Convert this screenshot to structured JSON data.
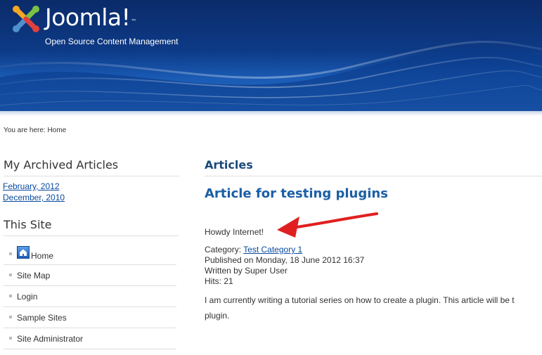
{
  "header": {
    "logo_text": "Joomla!",
    "logo_tm": "™",
    "tagline": "Open Source Content Management"
  },
  "breadcrumb": "You are here: Home",
  "sidebar": {
    "archive_heading": "My Archived Articles",
    "archive_links": [
      "February, 2012",
      "December, 2010"
    ],
    "site_heading": "This Site",
    "menu": [
      "Home",
      "Site Map",
      "Login",
      "Sample Sites",
      "Site Administrator"
    ]
  },
  "main": {
    "heading": "Articles",
    "article_title": "Article for testing plugins",
    "intro": "Howdy Internet!",
    "category_label": "Category: ",
    "category_link": "Test Category 1",
    "published": "Published on Monday, 18 June 2012 16:37",
    "written_by": "Written by Super User",
    "hits": "Hits: 21",
    "body_line1": "I am currently writing a tutorial series on how to create a plugin. This article will be t",
    "body_line2": "plugin."
  },
  "colors": {
    "header_bg": "#0d3a86",
    "link": "#094a9e",
    "heading": "#1b4a7a",
    "arrow": "#e02020"
  }
}
